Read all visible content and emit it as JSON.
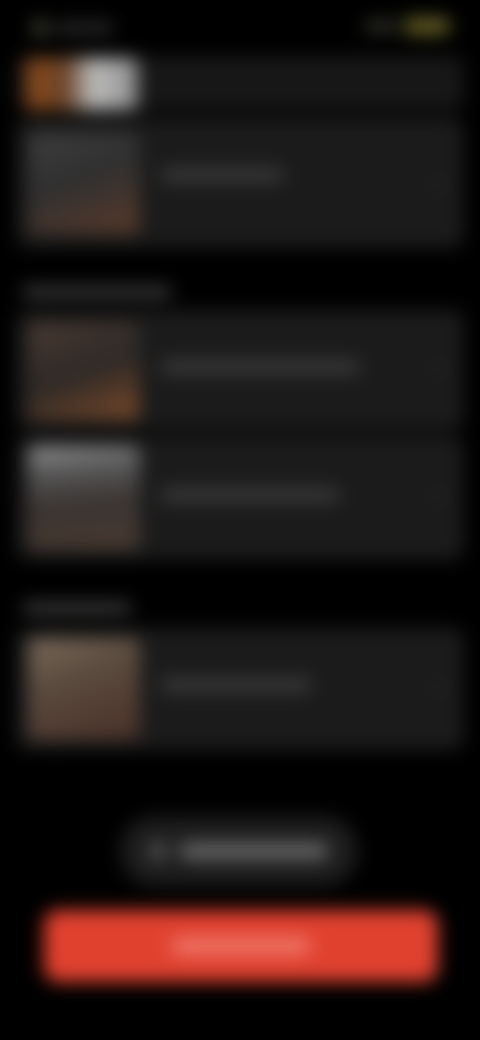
{
  "colors": {
    "background": "#000000",
    "card": "#1b1b1b",
    "primary_button": "#e0412f",
    "battery": "#6b6428"
  },
  "status_bar": {
    "battery_icon": "battery-icon",
    "signal_icon": "signal-icon"
  },
  "sections": [
    {
      "items": [
        {
          "thumbnail_colors": [
            "#3d3d3d",
            "#5a3a2a"
          ]
        }
      ]
    },
    {
      "items": [
        {
          "thumbnail_colors": [
            "#4a3a32",
            "#7a4a2a"
          ]
        },
        {
          "thumbnail_colors": [
            "#9a9a9a",
            "#4a3a30"
          ]
        }
      ]
    },
    {
      "items": [
        {
          "thumbnail_colors": [
            "#7a6a5a",
            "#4a3028"
          ]
        }
      ]
    }
  ],
  "buttons": {
    "secondary_icon": "check-icon",
    "primary_color": "#e0412f"
  }
}
